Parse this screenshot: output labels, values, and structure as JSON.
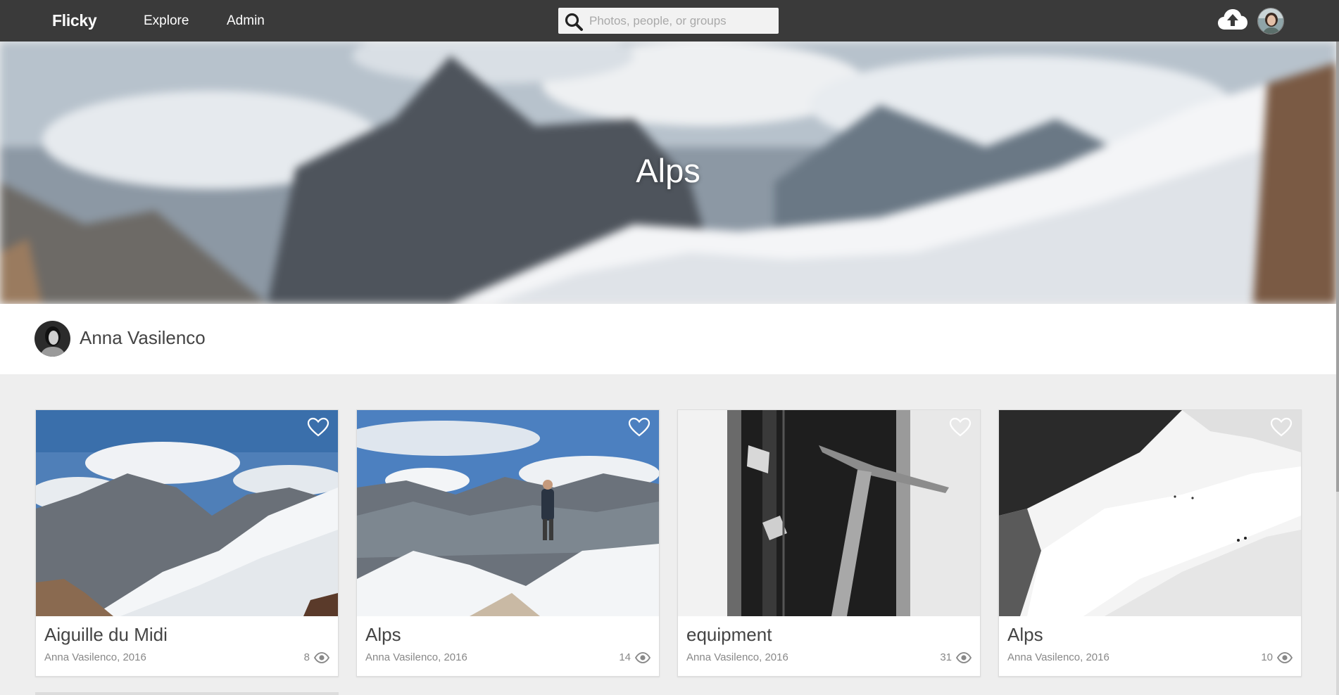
{
  "nav": {
    "brand": "Flicky",
    "explore": "Explore",
    "admin": "Admin",
    "search_placeholder": "Photos, people, or groups",
    "search_value": "",
    "icons": [
      "search-icon",
      "upload-cloud-icon",
      "user-avatar"
    ]
  },
  "album": {
    "title": "Alps",
    "owner": "Anna Vasilenco"
  },
  "photos": [
    {
      "title": "Aiguille du Midi",
      "meta": "Anna Vasilenco, 2016",
      "views": "8"
    },
    {
      "title": "Alps",
      "meta": "Anna Vasilenco, 2016",
      "views": "14"
    },
    {
      "title": "equipment",
      "meta": "Anna Vasilenco, 2016",
      "views": "31"
    },
    {
      "title": "Alps",
      "meta": "Anna Vasilenco, 2016",
      "views": "10"
    }
  ],
  "colors": {
    "topbar": "#3a3a3a",
    "page_background": "#eeeeee",
    "card_background": "#ffffff",
    "muted_text": "#888888"
  }
}
